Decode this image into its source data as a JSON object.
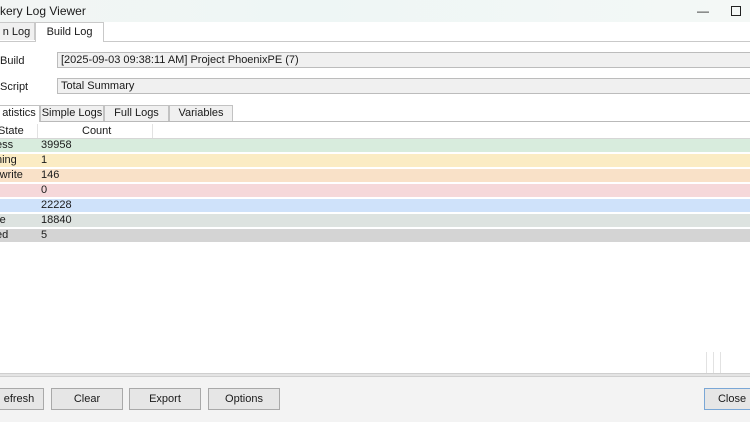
{
  "window": {
    "title": "kery Log Viewer",
    "minimize_glyph": "—",
    "maximize_glyph": ""
  },
  "top_tabs": [
    {
      "label": "n Log",
      "active": false
    },
    {
      "label": "Build Log",
      "active": true
    }
  ],
  "fields": {
    "build_label": "Build",
    "build_value": "[2025-09-03 09:38:11 AM] Project PhoenixPE (7)",
    "script_label": "Script",
    "script_value": "Total Summary"
  },
  "sub_tabs": [
    {
      "label": "atistics",
      "active": true
    },
    {
      "label": "Simple Logs",
      "active": false
    },
    {
      "label": "Full Logs",
      "active": false
    },
    {
      "label": "Variables",
      "active": false
    }
  ],
  "grid": {
    "columns": [
      "State",
      "Count"
    ],
    "rows": [
      {
        "state": "ess",
        "count": "39958",
        "color": "#d8ecdd"
      },
      {
        "state": "ning",
        "count": "1",
        "color": "#fbecc4"
      },
      {
        "state": "rwrite",
        "count": "146",
        "color": "#f9e1c8"
      },
      {
        "state": "r",
        "count": "0",
        "color": "#f6d8da"
      },
      {
        "state": "",
        "count": "22228",
        "color": "#cfe2fa"
      },
      {
        "state": "re",
        "count": "18840",
        "color": "#dde3e0"
      },
      {
        "state": "ed",
        "count": "5",
        "color": "#d4d4d4"
      }
    ]
  },
  "buttons": {
    "refresh": "efresh",
    "clear": "Clear",
    "export": "Export",
    "options": "Options",
    "close": "Close"
  }
}
